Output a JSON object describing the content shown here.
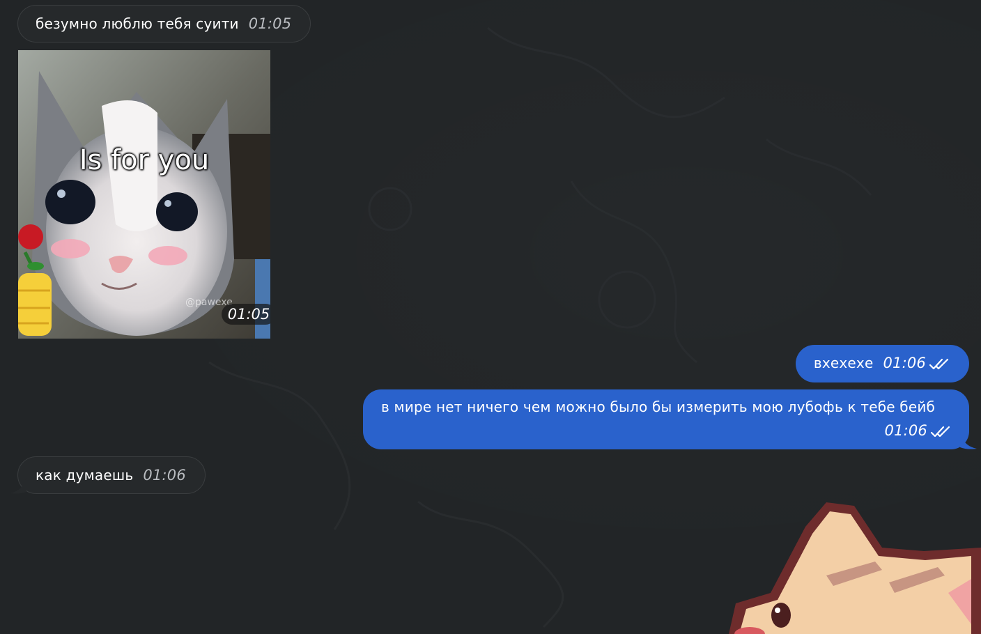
{
  "messages": [
    {
      "text": "безумно люблю тебя суити",
      "time": "01:05",
      "direction": "incoming"
    },
    {
      "sticker": {
        "caption": "Is for you",
        "watermark": "@pawexe",
        "time": "01:05"
      },
      "direction": "incoming"
    },
    {
      "text": "вхехехе",
      "time": "01:06",
      "direction": "outgoing",
      "status": "read"
    },
    {
      "text": "в мире нет ничего чем можно было бы измерить мою лубофь к тебе бейб",
      "time": "01:06",
      "direction": "outgoing",
      "status": "read"
    },
    {
      "text": "как думаешь",
      "time": "01:06",
      "direction": "incoming"
    }
  ],
  "colors": {
    "background": "#222527",
    "incoming_bubble": "#26292b",
    "outgoing_bubble": "#2a62cc",
    "timestamp_incoming": "#b9bcc0"
  },
  "icons": {
    "read_status": "double-check-icon",
    "bottom_sticker": "cat-sticker"
  }
}
